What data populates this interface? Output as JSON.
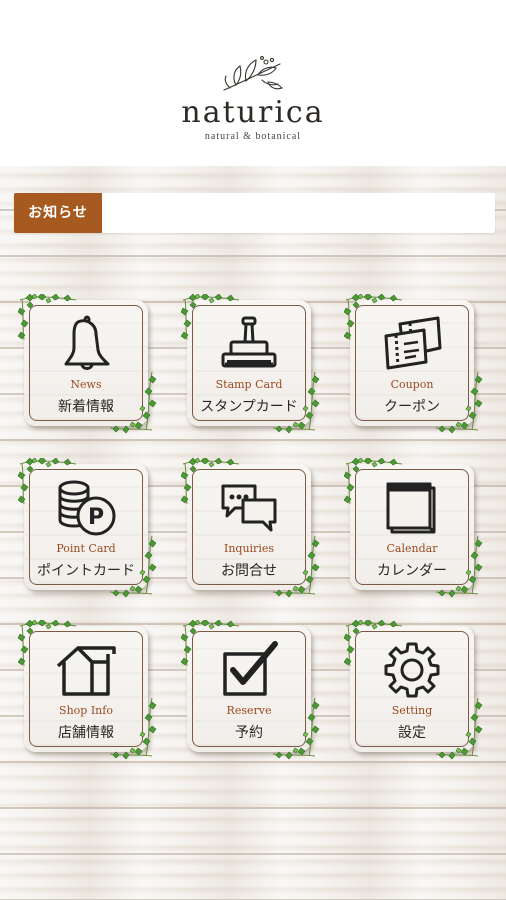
{
  "brand": {
    "name": "naturica",
    "tagline": "natural & botanical"
  },
  "notice": {
    "label": "お知らせ",
    "text": ""
  },
  "menu": [
    {
      "en": "News",
      "jp": "新着情報",
      "icon": "bell-icon"
    },
    {
      "en": "Stamp Card",
      "jp": "スタンプカード",
      "icon": "stamp-icon"
    },
    {
      "en": "Coupon",
      "jp": "クーポン",
      "icon": "coupon-icon"
    },
    {
      "en": "Point Card",
      "jp": "ポイントカード",
      "icon": "coins-icon"
    },
    {
      "en": "Inquiries",
      "jp": "お問合せ",
      "icon": "chat-bubbles-icon"
    },
    {
      "en": "Calendar",
      "jp": "カレンダー",
      "icon": "calendar-icon"
    },
    {
      "en": "Shop Info",
      "jp": "店舗情報",
      "icon": "house-icon"
    },
    {
      "en": "Reserve",
      "jp": "予約",
      "icon": "checkbox-icon"
    },
    {
      "en": "Setting",
      "jp": "設定",
      "icon": "gear-icon"
    }
  ],
  "colors": {
    "accent": "#a65a1f",
    "label_en": "#9a4a1e",
    "ivy": "#3f8a2e"
  }
}
